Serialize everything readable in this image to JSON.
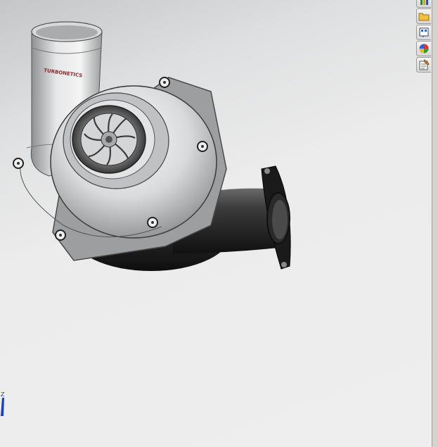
{
  "viewport": {
    "model_text": "TURBONETICS",
    "triad_axis": "Z",
    "background_top": "#c4c6c8",
    "background_bottom": "#eeeeee"
  },
  "task_pane": {
    "tabs": [
      {
        "icon": "resources-icon"
      },
      {
        "icon": "folder-icon"
      },
      {
        "icon": "view-palette-icon"
      },
      {
        "icon": "appearances-icon"
      },
      {
        "icon": "custom-properties-icon"
      }
    ]
  }
}
